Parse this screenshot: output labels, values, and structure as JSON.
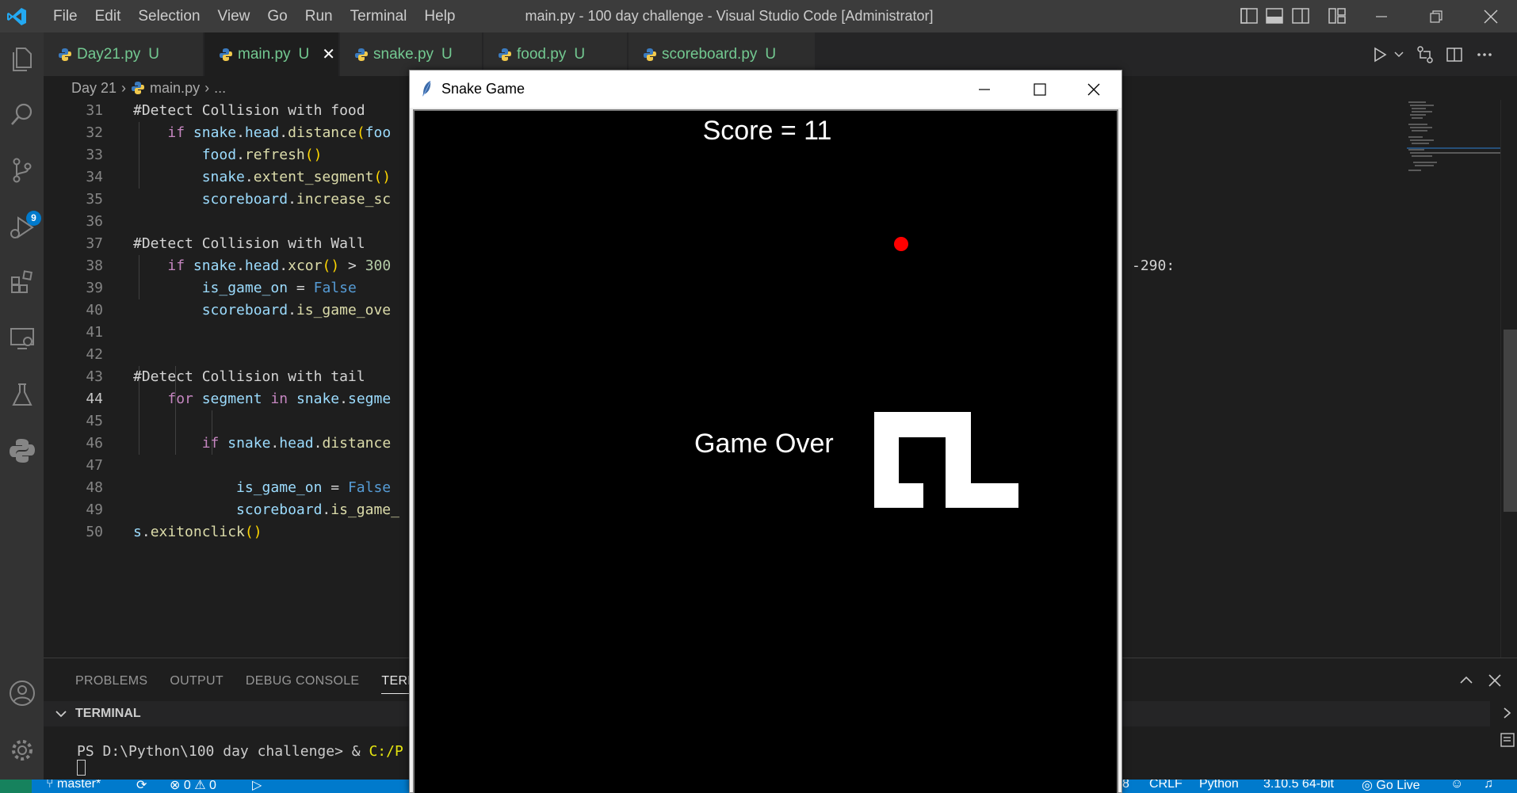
{
  "app": {
    "window_title": "main.py - 100 day challenge - Visual Studio Code [Administrator]",
    "menu": [
      "File",
      "Edit",
      "Selection",
      "View",
      "Go",
      "Run",
      "Terminal",
      "Help"
    ]
  },
  "activity_bar": {
    "source_control_badge": "9",
    "icons": [
      "explorer-icon",
      "search-icon",
      "source-control-icon",
      "run-debug-icon",
      "extensions-icon",
      "remote-explorer-icon",
      "testing-icon",
      "python-icon",
      "account-icon",
      "settings-gear-icon"
    ]
  },
  "tabs": [
    {
      "name": "Day21.py",
      "flag": "U"
    },
    {
      "name": "main.py",
      "flag": "U",
      "active": true
    },
    {
      "name": "snake.py",
      "flag": "U"
    },
    {
      "name": "food.py",
      "flag": "U"
    },
    {
      "name": "scoreboard.py",
      "flag": "U"
    }
  ],
  "breadcrumb": {
    "folder": "Day 21",
    "file": "main.py",
    "more": "..."
  },
  "editor": {
    "current_line": 44,
    "line_numbers": [
      "31",
      "32",
      "33",
      "34",
      "35",
      "36",
      "37",
      "38",
      "39",
      "40",
      "41",
      "42",
      "43",
      "44",
      "45",
      "46",
      "47",
      "48",
      "49",
      "50"
    ],
    "line_38_tail": "-290:"
  },
  "panel": {
    "tabs": [
      "PROBLEMS",
      "OUTPUT",
      "DEBUG CONSOLE",
      "TERMI"
    ],
    "terminal_title": "TERMINAL",
    "prompt": "PS D:\\Python\\100 day challenge> & ",
    "command": "C:/P"
  },
  "status_bar": {
    "branch": "master*",
    "errors": "0",
    "warnings": "0",
    "eol": "CRLF",
    "language": "Python",
    "interpreter": "3.10.5 64-bit",
    "go_live": "Go Live"
  },
  "snake_window": {
    "title": "Snake Game",
    "score_text": "Score = 11",
    "game_over_text": "Game Over",
    "food_color": "#ff0000",
    "background": "#000000"
  },
  "colors": {
    "accent": "#007acc",
    "git_untracked": "#73c991",
    "keyword": "#c586c0",
    "variable": "#9cdcfe",
    "function": "#dcdcaa",
    "boolean": "#569cd6"
  }
}
